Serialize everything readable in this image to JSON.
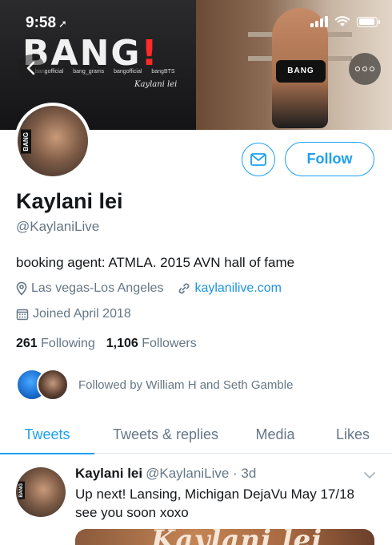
{
  "status_bar": {
    "time": "9:58",
    "location_arrow": "➚"
  },
  "banner": {
    "logo_text": "BANG",
    "logo_exclaim": "!",
    "social_handles": [
      "bangofficial",
      "bang_grams",
      "bangofficial",
      "bangBTS"
    ],
    "signature": "Kaylani lei",
    "figure_top_text": "BANG"
  },
  "avatar": {
    "tag": "BANG"
  },
  "actions": {
    "follow_label": "Follow"
  },
  "profile": {
    "name": "Kaylani lei",
    "handle": "@KaylaniLive",
    "bio": "booking agent: ATMLA. 2015 AVN hall of fame",
    "location": "Las vegas-Los Angeles",
    "website": "kaylanilive.com",
    "joined": "Joined April 2018",
    "following_count": "261",
    "following_label": "Following",
    "followers_count": "1,106",
    "followers_label": "Followers",
    "followed_by": "Followed by William H and Seth Gamble"
  },
  "tabs": [
    {
      "label": "Tweets",
      "active": true
    },
    {
      "label": "Tweets & replies",
      "active": false
    },
    {
      "label": "Media",
      "active": false
    },
    {
      "label": "Likes",
      "active": false
    }
  ],
  "tweet": {
    "author_name": "Kaylani lei",
    "author_handle": "@KaylaniLive",
    "time": "· 3d",
    "text": "Up next! Lansing, Michigan DejaVu May 17/18 see you soon xoxo",
    "media_title": "Kaylani lei",
    "avatar_tag": "BANG"
  },
  "colors": {
    "accent": "#1da1f2",
    "secondary_text": "#657786",
    "primary_text": "#14171a"
  }
}
